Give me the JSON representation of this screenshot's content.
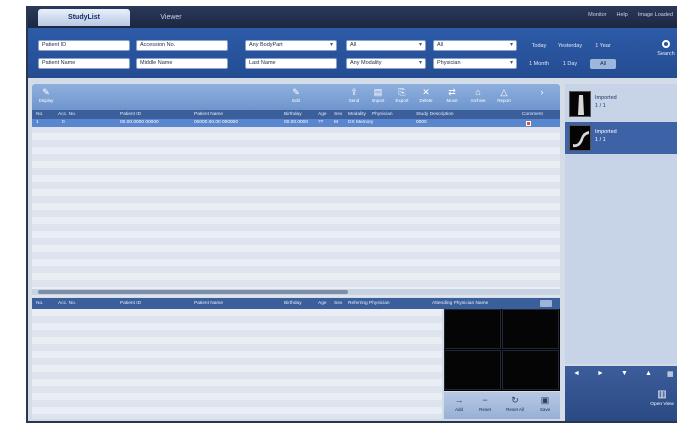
{
  "tabs": [
    {
      "label": "StudyList",
      "active": true
    },
    {
      "label": "Viewer",
      "active": false
    }
  ],
  "top_links": [
    "Monitor",
    "Help",
    "Image Loaded"
  ],
  "filters": {
    "patient_id": "Patient ID",
    "accession_no": "Accession No.",
    "body_part": "Any BodyPart",
    "filter_all_1": "All",
    "filter_all_2": "All",
    "patient_name": "Patient Name",
    "middle_name": "Middle Name",
    "last_name": "Last Name",
    "modality": "Any Modality",
    "physician": "Physician",
    "date_row1": [
      "Today",
      "Yesterday",
      "1 Year"
    ],
    "date_row2": [
      "1 Month",
      "1 Day",
      "All"
    ],
    "search_label": "Search"
  },
  "toolbar": {
    "left_tool": "Display",
    "tools": [
      "Edit",
      "Send",
      "Import",
      "Export",
      "Delete",
      "Move",
      "Archive",
      "Report"
    ]
  },
  "study_columns": [
    "No.",
    "Acc. No.",
    "Patient ID",
    "Patient Name",
    "Birthday",
    "Age",
    "Sex",
    "Modality",
    "Physician",
    "Study Description",
    "Comment"
  ],
  "selected_row": {
    "no": "1",
    "acc_no": "0",
    "patient_id": "00.00.0000 00000",
    "patient_name": "00000.00.00 000000",
    "birthday": "00.00.0000",
    "age": "??",
    "sex": "M",
    "modality": "DX Memory",
    "physician": "",
    "study_desc": "0000"
  },
  "series_columns": [
    "No.",
    "Acc. No.",
    "Patient ID",
    "Patient Name",
    "Birthday",
    "Age",
    "Sex",
    "Referring Physician",
    "Attending Physician Name"
  ],
  "viewer_tools": [
    "Add",
    "Reset",
    "Reset All",
    "Save"
  ],
  "thumbnails": [
    {
      "title": "Imported",
      "count": "1 / 1",
      "selected": false
    },
    {
      "title": "Imported",
      "count": "1 / 1",
      "selected": true
    }
  ],
  "right_nav": [
    "◄",
    "►",
    "▼",
    "▲",
    "▦"
  ],
  "open_view_label": "Open View",
  "colors": {
    "accent": "#2d5ba8",
    "selected_row": "#5a86cf",
    "header": "#3b5f9b"
  }
}
